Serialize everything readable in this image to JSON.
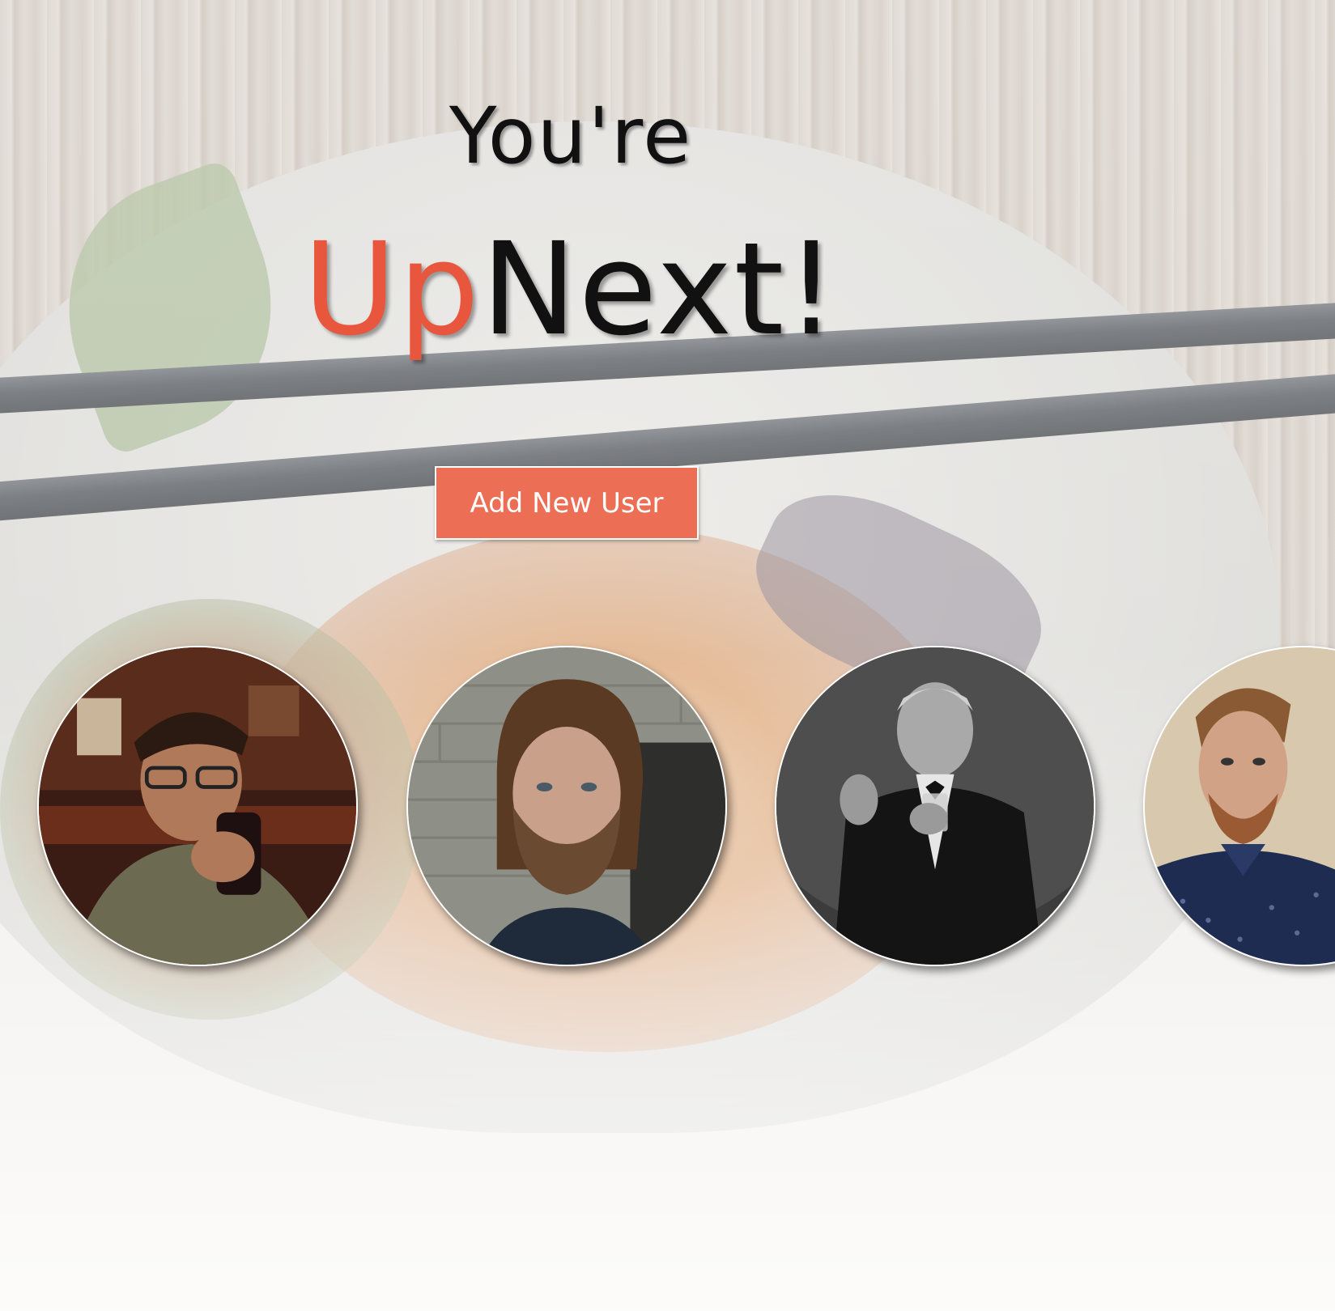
{
  "heading": {
    "line1": "You're",
    "brand_part1": "Up",
    "brand_part2": "Next!"
  },
  "actions": {
    "add_user_label": "Add New User"
  },
  "colors": {
    "accent": "#e8573d",
    "button": "#ec6f55",
    "heading_text": "#111111"
  },
  "users": [
    {
      "photo_style": "warm-bar-photo-glasses"
    },
    {
      "photo_style": "brick-wall-bearded"
    },
    {
      "photo_style": "black-and-white-suit"
    },
    {
      "photo_style": "beige-wall-navy-shirt"
    }
  ]
}
